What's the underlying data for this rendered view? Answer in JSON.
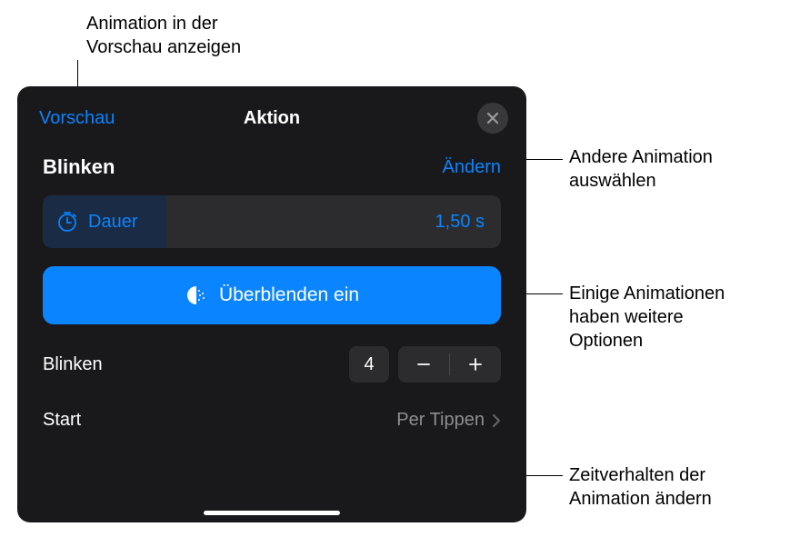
{
  "callouts": {
    "preview": "Animation in der\nVorschau anzeigen",
    "change": "Andere Animation\nauswählen",
    "options": "Einige Animationen\nhaben weitere\nOptionen",
    "timing": "Zeitverhalten der\nAnimation ändern"
  },
  "header": {
    "preview_btn": "Vorschau",
    "title": "Aktion"
  },
  "subheader": {
    "title": "Blinken",
    "change_btn": "Ändern"
  },
  "duration": {
    "label": "Dauer",
    "value": "1,50 s"
  },
  "blend": {
    "label": "Überblenden ein"
  },
  "stepper": {
    "label": "Blinken",
    "value": "4"
  },
  "start": {
    "label": "Start",
    "value": "Per Tippen"
  }
}
